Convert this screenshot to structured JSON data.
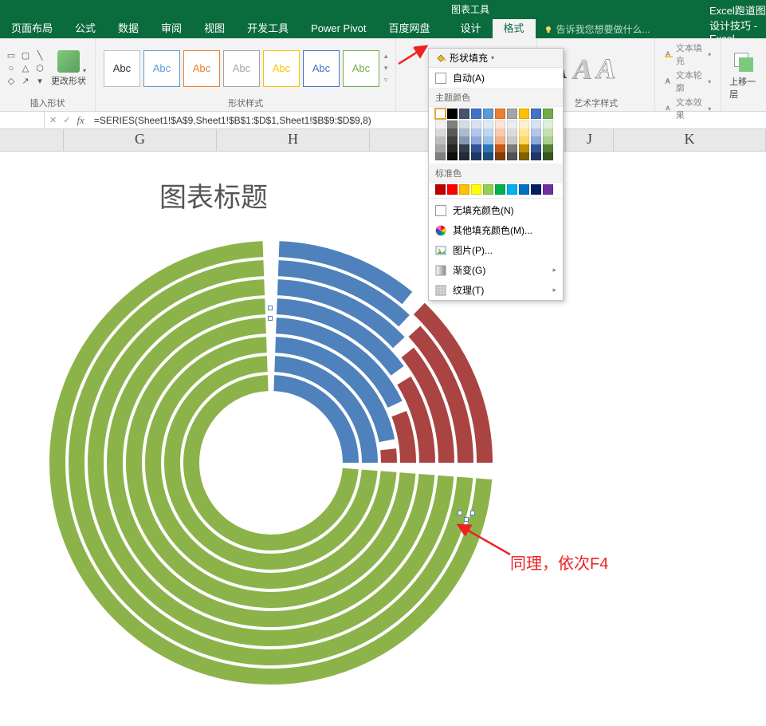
{
  "titlebar": {
    "chart_tools": "图表工具",
    "filename": "Excel跑道图设计技巧 - Excel"
  },
  "tabs": {
    "page_layout": "页面布局",
    "formulas": "公式",
    "data": "数据",
    "review": "审阅",
    "view": "视图",
    "developer": "开发工具",
    "power_pivot": "Power Pivot",
    "baidu": "百度网盘",
    "design": "设计",
    "format": "格式",
    "tell_me": "告诉我您想要做什么..."
  },
  "ribbon": {
    "insert_shapes_label": "插入形状",
    "change_shape": "更改形状",
    "shape_styles_label": "形状样式",
    "abc": "Abc",
    "wordart_label": "艺术字样式",
    "text_fill": "文本填充",
    "text_outline": "文本轮廓",
    "text_effects": "文本效果",
    "bring_forward": "上移一层"
  },
  "dropdown": {
    "shape_fill": "形状填充",
    "auto": "自动(A)",
    "theme_colors": "主题颜色",
    "standard_colors": "标准色",
    "no_fill": "无填充颜色(N)",
    "more_colors": "其他填充颜色(M)...",
    "picture": "图片(P)...",
    "gradient": "渐变(G)",
    "texture": "纹理(T)"
  },
  "formula_bar": {
    "fx": "fx",
    "formula": "=SERIES(Sheet1!$A$9,Sheet1!$B$1:$D$1,Sheet1!$B$9:$D$9,8)"
  },
  "columns": {
    "G": "G",
    "H": "H",
    "J": "J",
    "K": "K"
  },
  "chart": {
    "title": "图表标题"
  },
  "annotation": {
    "text": "同理，依次F4"
  },
  "theme_colors_row": [
    "#ffffff",
    "#000000",
    "#44546a",
    "#4472c4",
    "#5b9bd5",
    "#ed7d31",
    "#a5a5a5",
    "#ffc000",
    "#4472c4",
    "#70ad47"
  ],
  "theme_shades": [
    [
      "#f2f2f2",
      "#7f7f7f",
      "#d6dce5",
      "#d9e1f2",
      "#deebf7",
      "#fce4d6",
      "#ededed",
      "#fff2cc",
      "#d9e1f2",
      "#e2efda"
    ],
    [
      "#d9d9d9",
      "#595959",
      "#adb9ca",
      "#b4c6e7",
      "#bdd7ee",
      "#f8cbad",
      "#dbdbdb",
      "#ffe699",
      "#b4c6e7",
      "#c6e0b4"
    ],
    [
      "#bfbfbf",
      "#404040",
      "#8497b0",
      "#8ea9db",
      "#9bc2e6",
      "#f4b084",
      "#c9c9c9",
      "#ffd966",
      "#8ea9db",
      "#a9d08e"
    ],
    [
      "#a6a6a6",
      "#262626",
      "#333f4f",
      "#305496",
      "#2f75b5",
      "#c65911",
      "#7b7b7b",
      "#bf8f00",
      "#305496",
      "#548235"
    ],
    [
      "#808080",
      "#0d0d0d",
      "#222b35",
      "#203764",
      "#1f4e78",
      "#833c0c",
      "#525252",
      "#806000",
      "#203764",
      "#375623"
    ]
  ],
  "standard_colors": [
    "#c00000",
    "#ff0000",
    "#ffc000",
    "#ffff00",
    "#92d050",
    "#00b050",
    "#00b0f0",
    "#0070c0",
    "#002060",
    "#7030a0"
  ],
  "chart_data": {
    "type": "doughnut-racetrack",
    "title": "图表标题",
    "rings": [
      {
        "index": 1,
        "green": 75,
        "blue": 25,
        "red": 0,
        "none": 0
      },
      {
        "index": 2,
        "green": 75,
        "blue": 25,
        "red": 0,
        "none": 0
      },
      {
        "index": 3,
        "green": 75,
        "blue": 22,
        "red": 3,
        "none": 0
      },
      {
        "index": 4,
        "green": 75,
        "blue": 18,
        "red": 7,
        "none": 0
      },
      {
        "index": 5,
        "green": 75,
        "blue": 15,
        "red": 10,
        "none": 0
      },
      {
        "index": 6,
        "green": 75,
        "blue": 13,
        "red": 12,
        "none": 0
      },
      {
        "index": 7,
        "green": 75,
        "blue": 12,
        "red": 13,
        "none": 0
      },
      {
        "index": 8,
        "green": 75,
        "blue": 11,
        "red": 14,
        "none": 0,
        "selected": true
      }
    ],
    "colors": {
      "green": "#8cb34a",
      "blue": "#4f81bd",
      "red": "#a94442",
      "gap": "#ffffff"
    }
  }
}
